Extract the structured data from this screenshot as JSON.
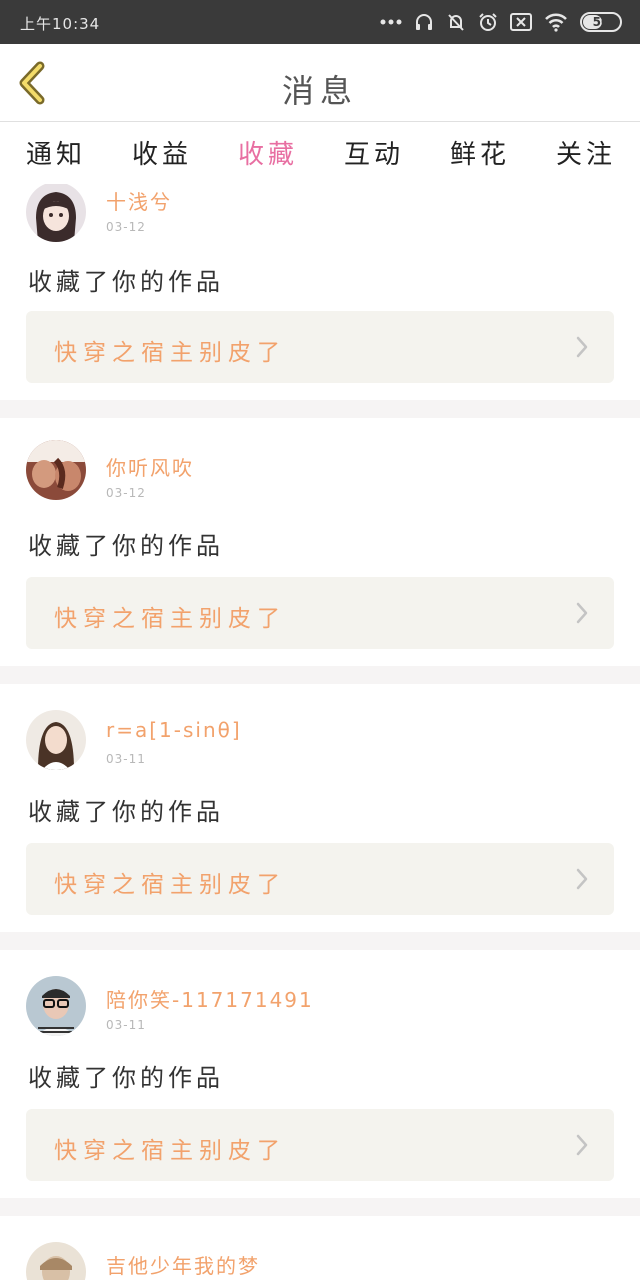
{
  "status_bar": {
    "time": "上午10:34",
    "battery": "50",
    "icons": [
      "more-icon",
      "headset-icon",
      "muted-bell-icon",
      "alarm-icon",
      "sim-off-icon",
      "wifi-icon",
      "battery-icon"
    ]
  },
  "header": {
    "title": "消息",
    "back_icon": "chevron-left-icon"
  },
  "tabs": [
    {
      "label": "通知",
      "active": false
    },
    {
      "label": "收益",
      "active": false
    },
    {
      "label": "收藏",
      "active": true
    },
    {
      "label": "互动",
      "active": false
    },
    {
      "label": "鲜花",
      "active": false
    },
    {
      "label": "关注",
      "active": false
    }
  ],
  "notifications": [
    {
      "user": "十浅兮",
      "date": "03-12",
      "action": "收藏了你的作品",
      "work": "快穿之宿主别皮了"
    },
    {
      "user": "你听风吹",
      "date": "03-12",
      "action": "收藏了你的作品",
      "work": "快穿之宿主别皮了"
    },
    {
      "user": "r=a[1-sinθ]",
      "date": "03-11",
      "action": "收藏了你的作品",
      "work": "快穿之宿主别皮了"
    },
    {
      "user": "陪你笑-117171491",
      "date": "03-11",
      "action": "收藏了你的作品",
      "work": "快穿之宿主别皮了"
    },
    {
      "user": "吉他少年我的梦",
      "date": "",
      "action": "",
      "work": ""
    }
  ],
  "colors": {
    "accent": "#e86fa2",
    "orange": "#f2a26c",
    "status_bar": "#3a3a3a",
    "work_box": "#f4f3ee",
    "divider": "#f6f4f4"
  }
}
